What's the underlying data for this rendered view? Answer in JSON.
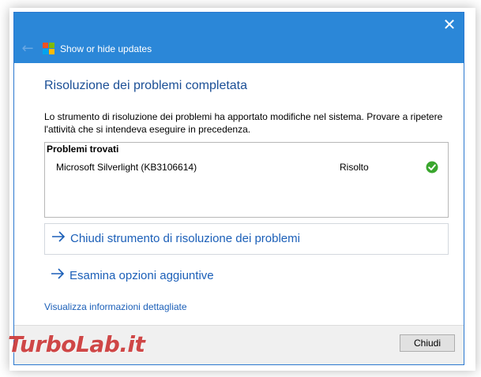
{
  "window": {
    "title": "Show or hide updates",
    "close_glyph": "✕",
    "back_glyph": "←"
  },
  "content": {
    "heading": "Risoluzione dei problemi completata",
    "description": "Lo strumento di risoluzione dei problemi ha apportato modifiche nel sistema. Provare a ripetere l'attività che si intendeva eseguire in precedenza.",
    "problems": {
      "header": "Problemi trovati",
      "items": [
        {
          "name": "Microsoft Silverlight (KB3106614)",
          "status": "Risolto",
          "status_icon": "green-check-icon"
        }
      ]
    },
    "actions": [
      {
        "label": "Chiudi strumento di risoluzione dei problemi"
      },
      {
        "label": "Esamina opzioni aggiuntive"
      }
    ],
    "details_link": "Visualizza informazioni dettagliate"
  },
  "footer": {
    "close_button": "Chiudi"
  },
  "watermark": {
    "text": "TurboLab.it"
  },
  "colors": {
    "title_bar": "#2b87d8",
    "heading": "#1b4f96",
    "link": "#1b5fb8",
    "success": "#3aa62e"
  }
}
